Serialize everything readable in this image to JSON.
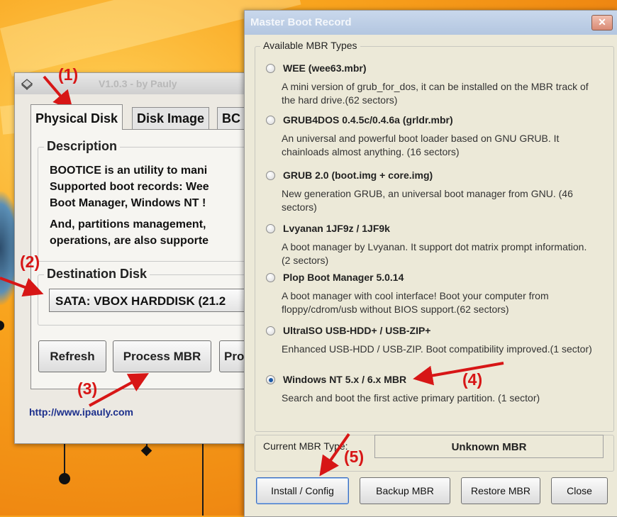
{
  "colors": {
    "annotation_red": "#d71616",
    "desktop_orange": "#f7a320",
    "dialog_bg": "#ece9d8",
    "link_blue": "#1c2f8c"
  },
  "bootice": {
    "title": "V1.0.3 - by Pauly",
    "icon": "disk-drive-icon",
    "tabs": [
      "Physical Disk",
      "Disk Image",
      "BC"
    ],
    "description_legend": "Description",
    "description_lines": [
      "BOOTICE is an utility to mani",
      "Supported boot records: Wee",
      "Boot Manager, Windows NT !",
      "And, partitions management,",
      "operations, are also supporte"
    ],
    "destination_legend": "Destination Disk",
    "destination_value": "SATA: VBOX HARDDISK (21.2",
    "buttons": {
      "refresh": "Refresh",
      "process_mbr": "Process MBR",
      "process_pbr": "Pro"
    },
    "link": "http://www.ipauly.com"
  },
  "mbr_dialog": {
    "title": "Master Boot Record",
    "close_glyph": "✕",
    "types_legend": "Available MBR Types",
    "options": [
      {
        "label": "WEE (wee63.mbr)",
        "desc": "A mini version of grub_for_dos, it can be installed on the MBR track of the hard drive.(62 sectors)",
        "selected": false
      },
      {
        "label": "GRUB4DOS 0.4.5c/0.4.6a (grldr.mbr)",
        "desc": "An universal and powerful boot loader based on GNU GRUB. It chainloads almost anything. (16 sectors)",
        "selected": false
      },
      {
        "label": "GRUB 2.0 (boot.img + core.img)",
        "desc": "New generation GRUB, an universal boot manager from GNU. (46 sectors)",
        "selected": false
      },
      {
        "label": "Lvyanan 1JF9z / 1JF9k",
        "desc": "A boot manager by Lvyanan. It support dot matrix prompt information. (2 sectors)",
        "selected": false
      },
      {
        "label": "Plop Boot Manager 5.0.14",
        "desc": "A boot manager with cool interface! Boot your computer from floppy/cdrom/usb without BIOS support.(62 sectors)",
        "selected": false
      },
      {
        "label": "UltraISO USB-HDD+ / USB-ZIP+",
        "desc": "Enhanced USB-HDD / USB-ZIP. Boot compatibility improved.(1 sector)",
        "selected": false
      },
      {
        "label": "Windows NT 5.x / 6.x MBR",
        "desc": "Search and boot the first active primary partition. (1 sector)",
        "selected": true
      }
    ],
    "current_label": "Current MBR Type:",
    "current_value": "Unknown MBR",
    "buttons": {
      "install": "Install / Config",
      "backup": "Backup MBR",
      "restore": "Restore MBR",
      "close": "Close"
    }
  },
  "annotations": {
    "step1": "(1)",
    "step2": "(2)",
    "step3": "(3)",
    "step4": "(4)",
    "step5": "(5)"
  }
}
